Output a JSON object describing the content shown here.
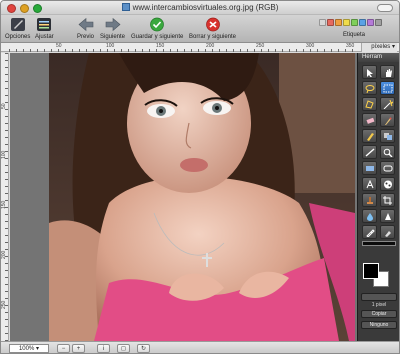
{
  "window": {
    "title": "www.intercambiosvirtuales.org.jpg (RGB)"
  },
  "toolbar": {
    "opciones": "Opciones",
    "ajustar": "Ajustar",
    "previo": "Previo",
    "siguiente": "Siguiente",
    "guardar": "Guardar y siguiente",
    "borrar": "Borrar y siguiente",
    "etiqueta": "Etiqueta",
    "tag_colors": [
      "#d8d8d8",
      "#e66a5f",
      "#f0a040",
      "#f0dc4a",
      "#7fcf5a",
      "#5aa2e6",
      "#b57ad8",
      "#a0a0a0"
    ]
  },
  "ruler": {
    "unit": "píxeles",
    "h_labels": [
      "50",
      "100",
      "150",
      "200",
      "250",
      "300",
      "350"
    ],
    "v_labels": [
      "50",
      "100",
      "150",
      "200",
      "250"
    ]
  },
  "palette": {
    "title": "Herram",
    "icons": [
      "arrow-icon",
      "hand-icon",
      "lasso-icon",
      "rect-select-icon",
      "poly-lasso-icon",
      "magic-wand-icon",
      "eraser-icon",
      "brush-icon",
      "pencil-icon",
      "clone-icon",
      "line-icon",
      "zoom-icon",
      "rectangle-icon",
      "rounded-rect-icon",
      "text-icon",
      "pattern-icon",
      "stamp-icon",
      "crop-icon",
      "drop-icon",
      "sharpen-icon",
      "eyedropper-icon",
      "brush-hand-icon"
    ],
    "pixel_label": "1 pixel",
    "copy_option": "Copiar",
    "none_option": "Ninguno"
  },
  "status": {
    "zoom": "100%"
  }
}
